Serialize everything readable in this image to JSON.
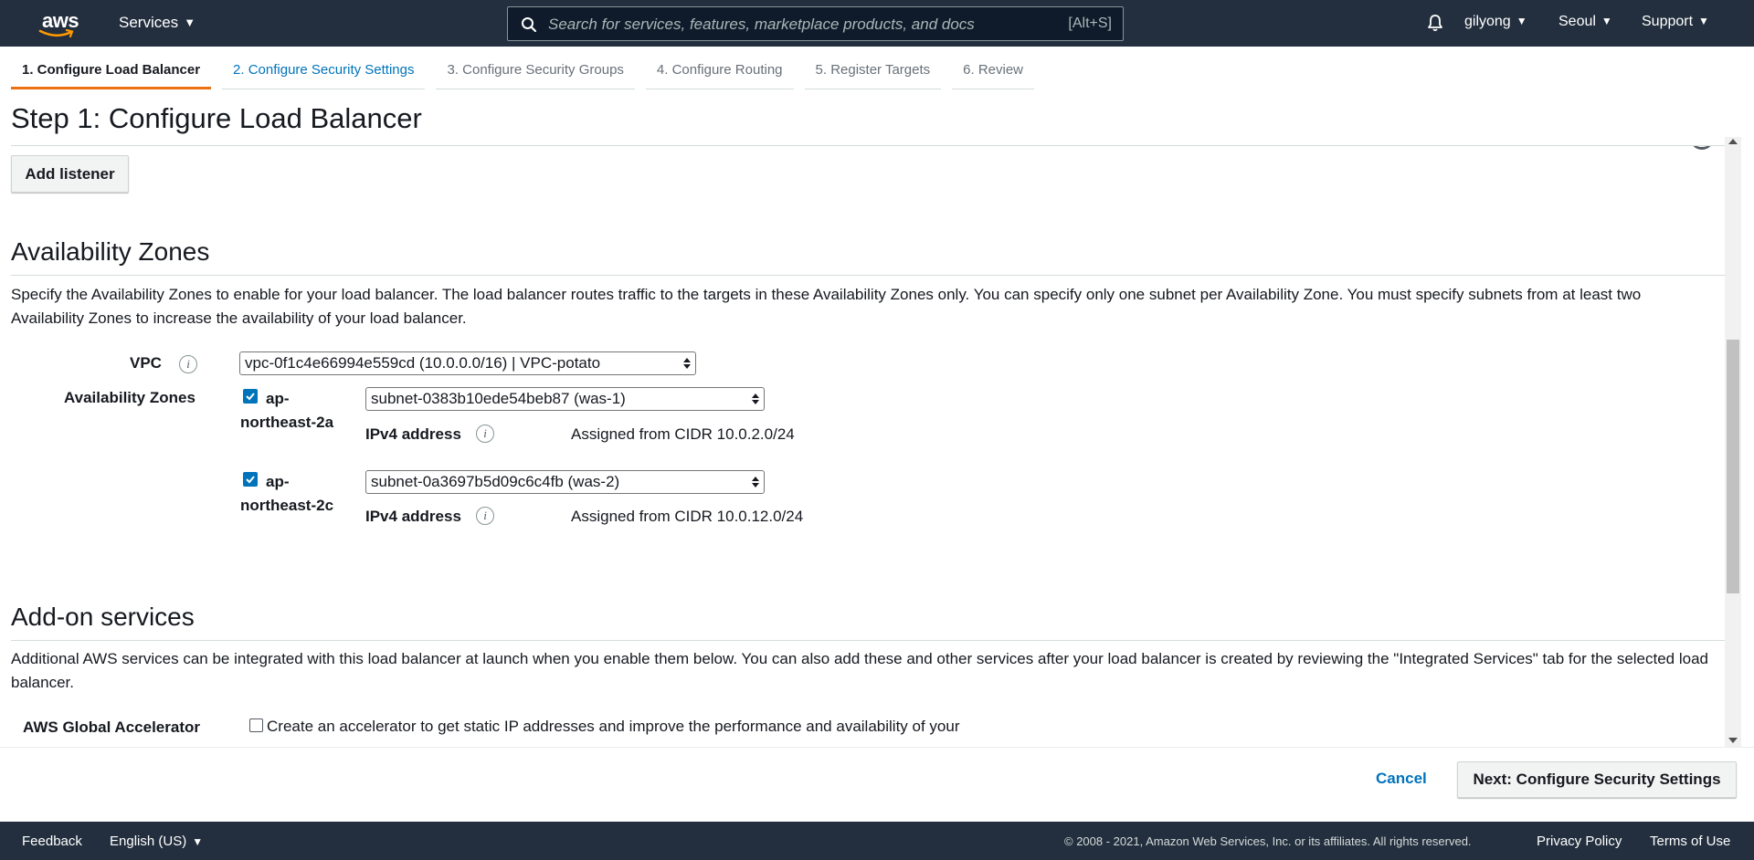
{
  "topnav": {
    "logo": "aws",
    "services_label": "Services",
    "search_placeholder": "Search for services, features, marketplace products, and docs",
    "search_shortcut": "[Alt+S]",
    "user": "gilyong",
    "region": "Seoul",
    "support": "Support",
    "icons": [
      "search-icon",
      "bell-icon",
      "caret-down-icon"
    ]
  },
  "wizard": {
    "steps": [
      {
        "label": "1. Configure Load Balancer",
        "state": "active"
      },
      {
        "label": "2. Configure Security Settings",
        "state": "next"
      },
      {
        "label": "3. Configure Security Groups",
        "state": "future"
      },
      {
        "label": "4. Configure Routing",
        "state": "future"
      },
      {
        "label": "5. Register Targets",
        "state": "future"
      },
      {
        "label": "6. Review",
        "state": "future"
      }
    ],
    "title": "Step 1: Configure Load Balancer"
  },
  "listeners": {
    "add_button": "Add listener"
  },
  "availability_zones": {
    "title": "Availability Zones",
    "description": "Specify the Availability Zones to enable for your load balancer. The load balancer routes traffic to the targets in these Availability Zones only. You can specify only one subnet per Availability Zone. You must specify subnets from at least two Availability Zones to increase the availability of your load balancer.",
    "vpc_label": "VPC",
    "vpc_value": "vpc-0f1c4e66994e559cd (10.0.0.0/16) | VPC-potato",
    "az_label": "Availability Zones",
    "zones": [
      {
        "name_line1": "ap-",
        "name_line2": "northeast-2a",
        "checked": true,
        "subnet": "subnet-0383b10ede54beb87 (was-1)",
        "ipv4_label": "IPv4 address",
        "cidr_text": "Assigned from CIDR 10.0.2.0/24"
      },
      {
        "name_line1": "ap-",
        "name_line2": "northeast-2c",
        "checked": true,
        "subnet": "subnet-0a3697b5d09c6c4fb (was-2)",
        "ipv4_label": "IPv4 address",
        "cidr_text": "Assigned from CIDR 10.0.12.0/24"
      }
    ]
  },
  "addons": {
    "title": "Add-on services",
    "description": "Additional AWS services can be integrated with this load balancer at launch when you enable them below. You can also add these and other services after your load balancer is created by reviewing the \"Integrated Services\" tab for the selected load balancer.",
    "accelerator_label": "AWS Global Accelerator",
    "accelerator_text": "Create an accelerator to get static IP addresses and improve the performance and availability of your",
    "accelerator_checked": false
  },
  "actions": {
    "cancel": "Cancel",
    "next": "Next: Configure Security Settings"
  },
  "footer": {
    "feedback": "Feedback",
    "language": "English (US)",
    "copyright": "© 2008 - 2021, Amazon Web Services, Inc. or its affiliates. All rights reserved.",
    "privacy": "Privacy Policy",
    "terms": "Terms of Use"
  },
  "colors": {
    "nav_bg": "#232f3e",
    "accent": "#ec7211",
    "link": "#0073bb"
  }
}
